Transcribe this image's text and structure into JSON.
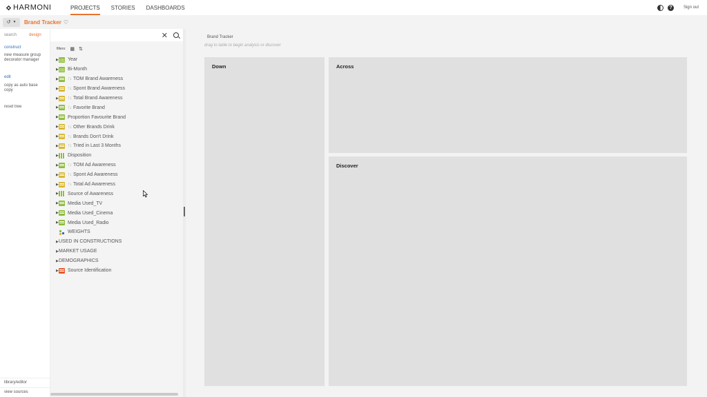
{
  "app": {
    "logo_text": "HARMONI",
    "nav": [
      "PROJECTS",
      "STORIES",
      "DASHBOARDS"
    ],
    "signout": "Sign out"
  },
  "project": {
    "title": "Brand Tracker"
  },
  "left_rail": {
    "tabs": [
      "search",
      "design"
    ],
    "construct_head": "construct",
    "construct_items": [
      "new measure group",
      "decorator manager"
    ],
    "edit_head": "edit",
    "edit_items": [
      "copy as auto base",
      "copy"
    ],
    "reset": "reset tree",
    "bottom_links": [
      "library/editor",
      "view sources"
    ]
  },
  "tree_panel": {
    "filters_label": "filters:",
    "nodes": [
      {
        "label": "Year",
        "icon": "date-icon",
        "caret": true,
        "arrows": false
      },
      {
        "label": "Bi-Month",
        "icon": "date-icon",
        "caret": true,
        "arrows": false
      },
      {
        "label": "TOM Brand Awareness",
        "icon": "category-icon",
        "caret": true,
        "arrows": true
      },
      {
        "label": "Spont Brand Awareness",
        "icon": "multi-icon",
        "caret": true,
        "arrows": true
      },
      {
        "label": "Total Brand Awareness",
        "icon": "multi-icon",
        "caret": true,
        "arrows": true
      },
      {
        "label": "Favorite Brand",
        "icon": "category-icon",
        "caret": true,
        "arrows": true
      },
      {
        "label": "Proportion Favourite Brand",
        "icon": "category-icon",
        "caret": true,
        "arrows": false
      },
      {
        "label": "Other Brands Drink",
        "icon": "multi-icon",
        "caret": true,
        "arrows": true
      },
      {
        "label": "Brands Don't Drink",
        "icon": "multi-icon",
        "caret": true,
        "arrows": true
      },
      {
        "label": "Tried in Last 3 Months",
        "icon": "multi-icon",
        "caret": true,
        "arrows": true
      },
      {
        "label": "Disposition",
        "icon": "grid-icon",
        "caret": true,
        "arrows": false
      },
      {
        "label": "TOM Ad Awareness",
        "icon": "category-icon",
        "caret": true,
        "arrows": true
      },
      {
        "label": "Spont Ad Awareness",
        "icon": "multi-icon",
        "caret": true,
        "arrows": true
      },
      {
        "label": "Total Ad Awareness",
        "icon": "multi-icon",
        "caret": true,
        "arrows": true
      },
      {
        "label": "Source of Awareness",
        "icon": "grid-icon",
        "caret": true,
        "arrows": false
      },
      {
        "label": "Media Used_TV",
        "icon": "category-icon",
        "caret": true,
        "arrows": false
      },
      {
        "label": "Media Used_Cinema",
        "icon": "category-icon",
        "caret": true,
        "arrows": false
      },
      {
        "label": "Media Used_Radio",
        "icon": "category-icon",
        "caret": true,
        "arrows": false
      },
      {
        "label": "WEIGHTS",
        "icon": "weights-icon",
        "caret": false,
        "arrows": false
      },
      {
        "label": "USED IN CONSTRUCTIONS",
        "icon": "",
        "caret": true,
        "arrows": false
      },
      {
        "label": "MARKET USAGE",
        "icon": "",
        "caret": true,
        "arrows": false
      },
      {
        "label": "DEMOGRAPHICS",
        "icon": "",
        "caret": true,
        "arrows": false
      },
      {
        "label": "Source Identification",
        "icon": "source-icon",
        "caret": true,
        "arrows": false
      }
    ]
  },
  "canvas": {
    "breadcrumb": "Brand Tracker",
    "hint": "drag to table to begin analysis or discover",
    "zones": [
      "Down",
      "Across",
      "Discover"
    ]
  },
  "colors": {
    "accent": "#e6722e",
    "link": "#2a6fb8",
    "icon_green": "#8dbd3a",
    "icon_yellow": "#d9b832"
  }
}
